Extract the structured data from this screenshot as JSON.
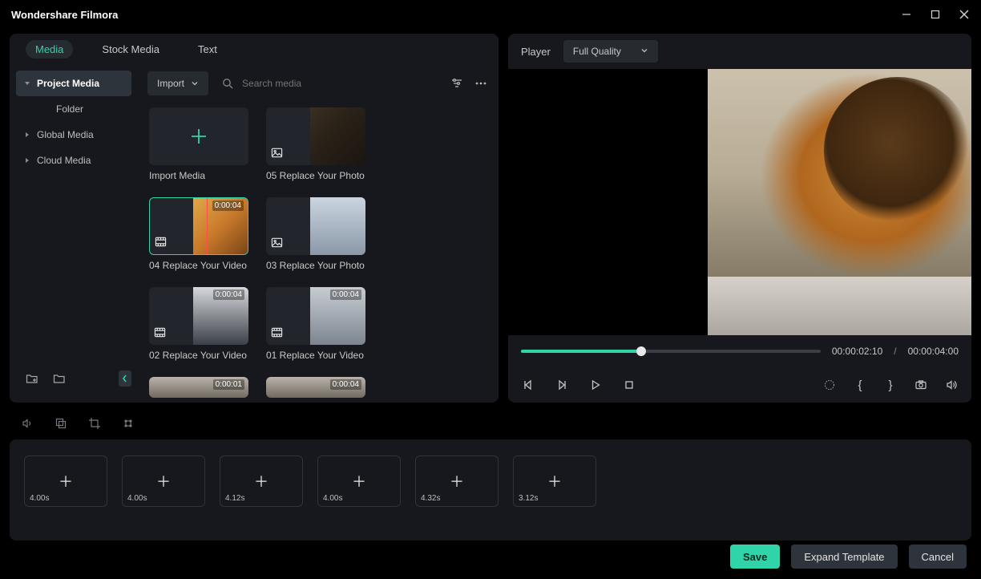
{
  "app": {
    "title": "Wondershare Filmora"
  },
  "tabs": [
    "Media",
    "Stock Media",
    "Text"
  ],
  "active_tab": "Media",
  "sidebar": {
    "items": [
      {
        "label": "Project Media",
        "expandable": true,
        "selected": true
      },
      {
        "label": "Folder",
        "expandable": false,
        "selected": false
      },
      {
        "label": "Global Media",
        "expandable": true,
        "selected": false
      },
      {
        "label": "Cloud Media",
        "expandable": true,
        "selected": false
      }
    ]
  },
  "toolbar": {
    "import_label": "Import",
    "search_placeholder": "Search media"
  },
  "media_items": [
    {
      "kind": "import",
      "label": "Import Media"
    },
    {
      "kind": "photo",
      "label": "05 Replace Your Photo",
      "photo_class": "p1"
    },
    {
      "kind": "video",
      "label": "04 Replace Your Video",
      "duration": "0:00:04",
      "selected": true,
      "photo_class": "p2"
    },
    {
      "kind": "photo",
      "label": "03 Replace Your Photo",
      "photo_class": "p3"
    },
    {
      "kind": "video",
      "label": "02 Replace Your Video",
      "duration": "0:00:04",
      "photo_class": "p4"
    },
    {
      "kind": "video",
      "label": "01 Replace Your Video",
      "duration": "0:00:04",
      "photo_class": "p5"
    },
    {
      "kind": "video",
      "label": "",
      "duration": "0:00:01",
      "photo_class": "p6",
      "small": true
    },
    {
      "kind": "video",
      "label": "",
      "duration": "0:00:04",
      "photo_class": "p6",
      "small": true
    }
  ],
  "player": {
    "label": "Player",
    "quality_label": "Full Quality",
    "current_time": "00:00:02:10",
    "total_time": "00:00:04:00",
    "progress_pct": 40
  },
  "timeline_slots": [
    {
      "duration": "4.00s"
    },
    {
      "duration": "4.00s"
    },
    {
      "duration": "4.12s"
    },
    {
      "duration": "4.00s"
    },
    {
      "duration": "4.32s"
    },
    {
      "duration": "3.12s"
    }
  ],
  "footer": {
    "save_label": "Save",
    "expand_label": "Expand Template",
    "cancel_label": "Cancel"
  }
}
